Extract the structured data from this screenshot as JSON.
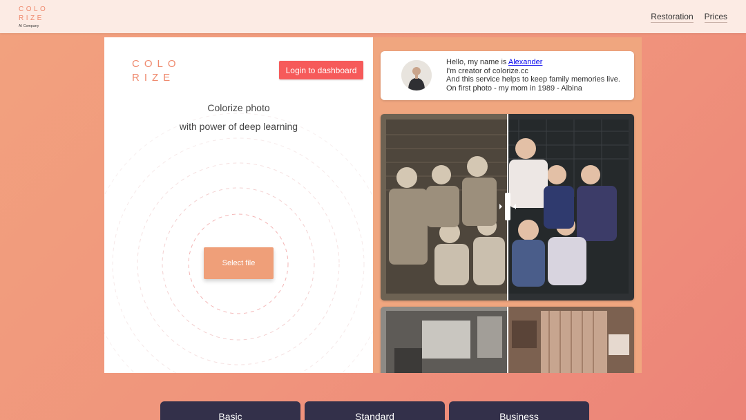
{
  "header": {
    "logo_line1": "COLO",
    "logo_line2": "RIZE",
    "logo_tagline": "AI Company",
    "nav": [
      {
        "label": "Restoration"
      },
      {
        "label": "Prices"
      }
    ]
  },
  "uploader": {
    "logo_line1": "COLO",
    "logo_line2": "RIZE",
    "login_label": "Login to dashboard",
    "headline": "Colorize photo",
    "subheadline": "with power of deep learning",
    "select_label": "Select file"
  },
  "creator": {
    "intro_prefix": "Hello, my name is ",
    "name_link": "Alexander",
    "line2": "I'm creator of colorize.cc",
    "line3": "And this service helps to keep family memories live.",
    "line4": "On first photo - my mom in 1989 -  Albina"
  },
  "plans": [
    {
      "label": "Basic"
    },
    {
      "label": "Standard"
    },
    {
      "label": "Business"
    }
  ],
  "colors": {
    "brand": "#ef8a6e",
    "login_button": "#f65a5a",
    "select_button": "#ef9f79",
    "plan_card": "#33304a"
  }
}
